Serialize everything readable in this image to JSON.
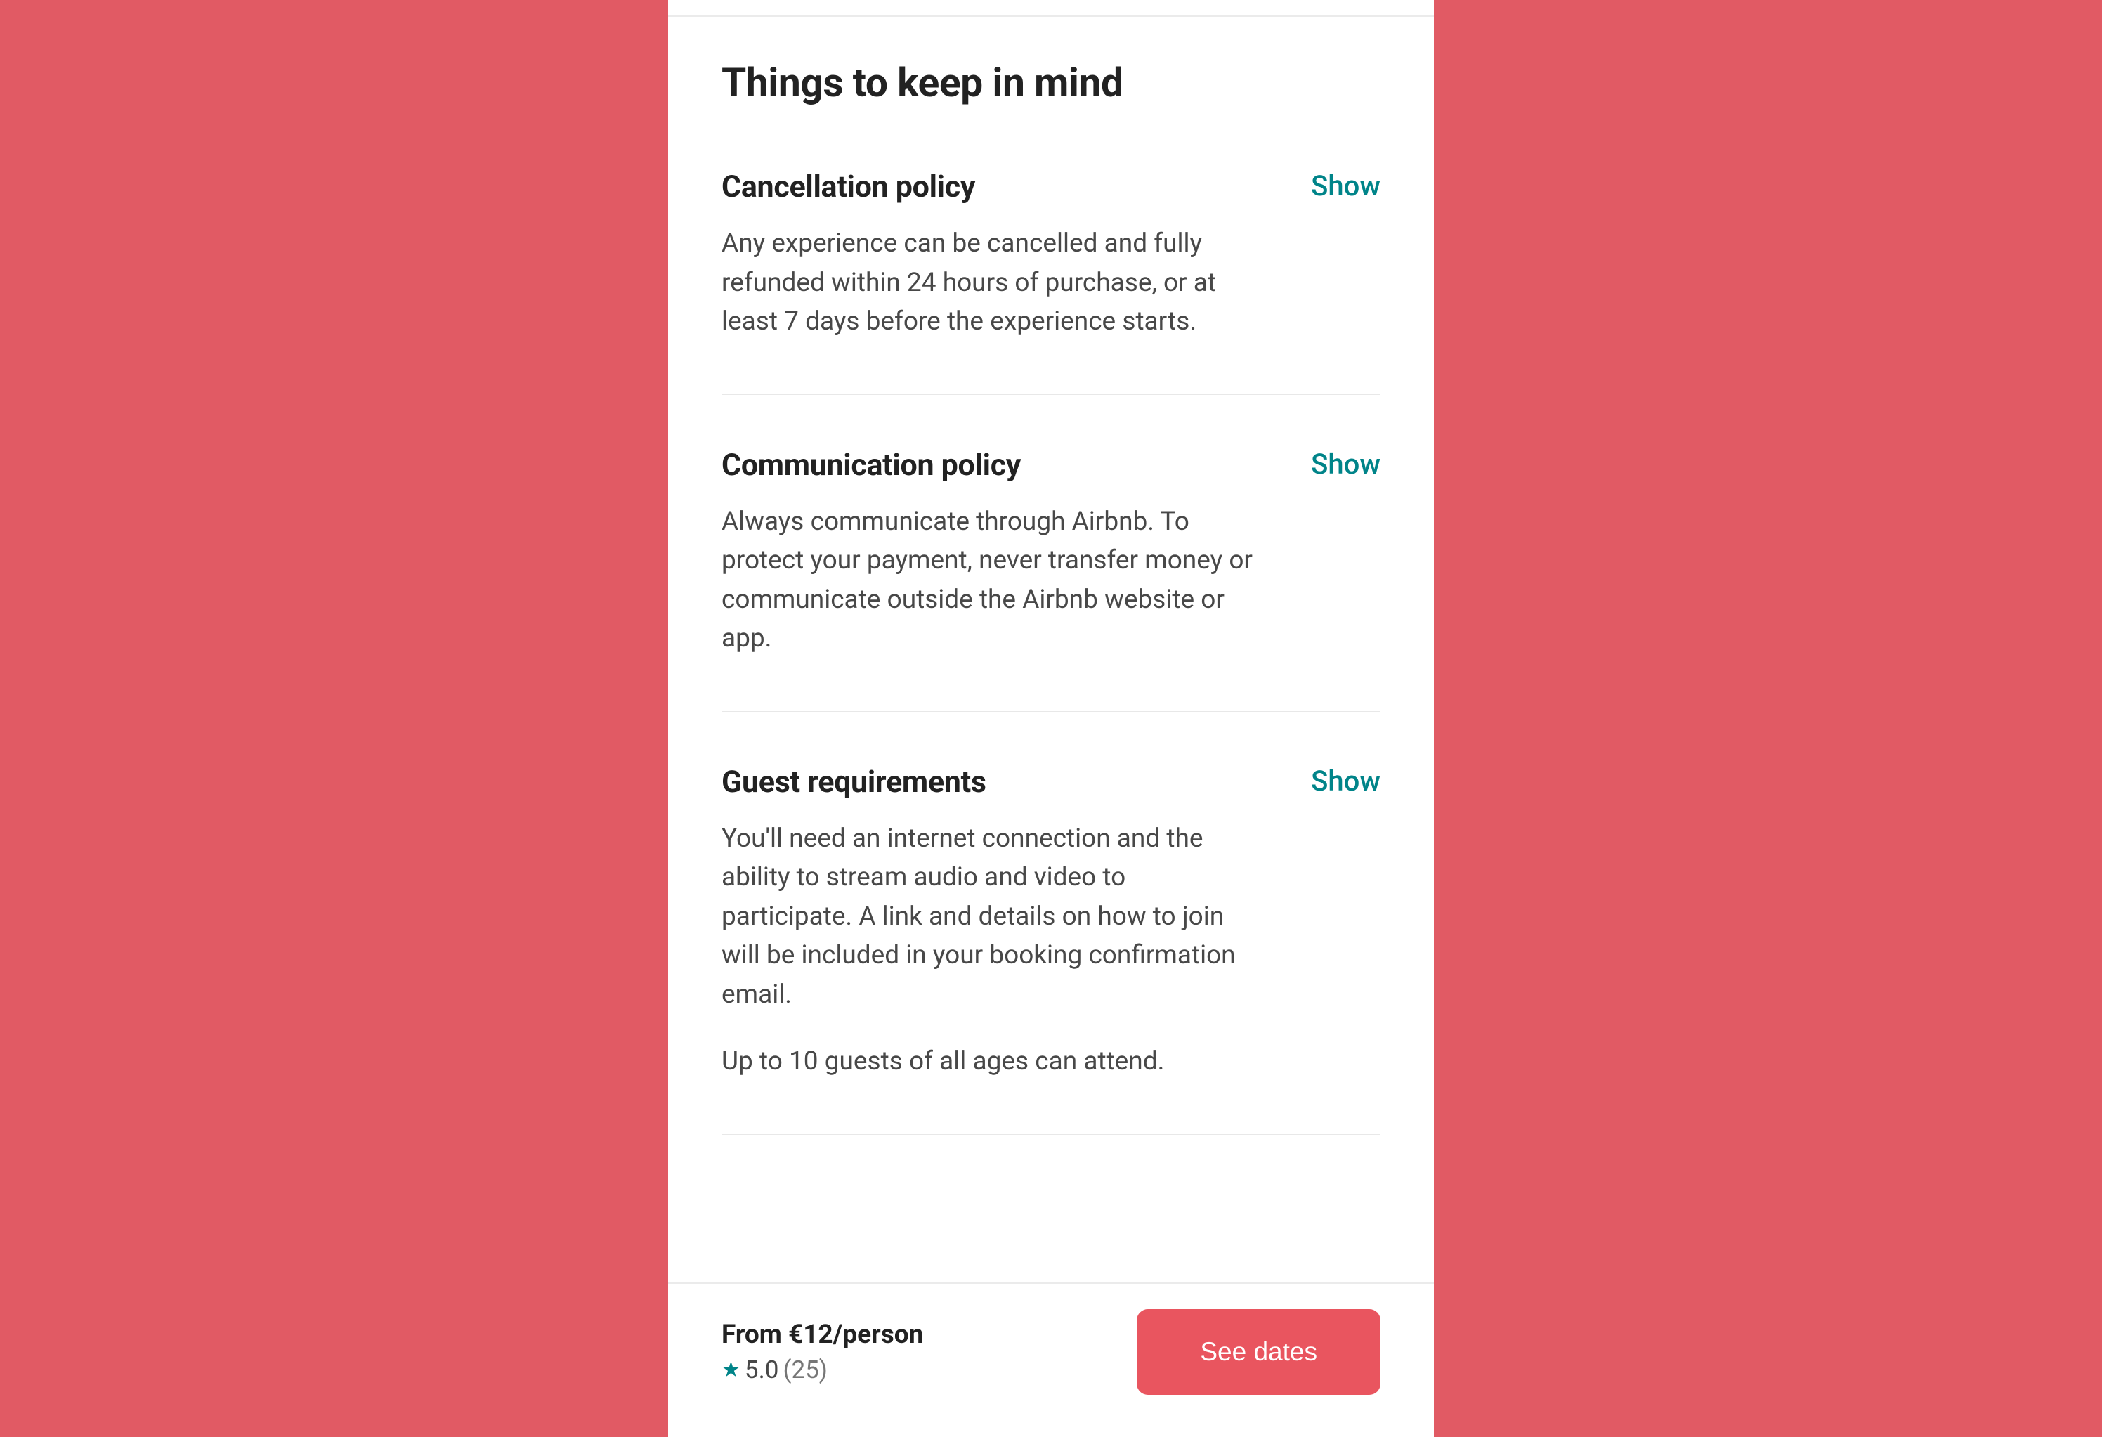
{
  "section": {
    "title": "Things to keep in mind"
  },
  "policies": [
    {
      "title": "Cancellation policy",
      "show_label": "Show",
      "body": [
        "Any experience can be cancelled and fully refunded within 24 hours of purchase, or at least 7 days before the experience starts."
      ]
    },
    {
      "title": "Communication policy",
      "show_label": "Show",
      "body": [
        "Always communicate through Airbnb. To protect your payment, never transfer money or communicate outside the Airbnb website or app."
      ]
    },
    {
      "title": "Guest requirements",
      "show_label": "Show",
      "body": [
        "You'll need an internet connection and the ability to stream audio and video to participate. A link and details on how to join will be included in your booking confirmation email.",
        "Up to 10 guests of all ages can attend."
      ]
    }
  ],
  "footer": {
    "price_text": "From €12/person",
    "rating_value": "5.0",
    "rating_count": "(25)",
    "cta_label": "See dates"
  },
  "colors": {
    "background": "#e15a64",
    "teal": "#008489",
    "cta": "#e9555f",
    "text_primary": "#222222",
    "text_secondary": "#484848",
    "text_muted": "#767676"
  }
}
